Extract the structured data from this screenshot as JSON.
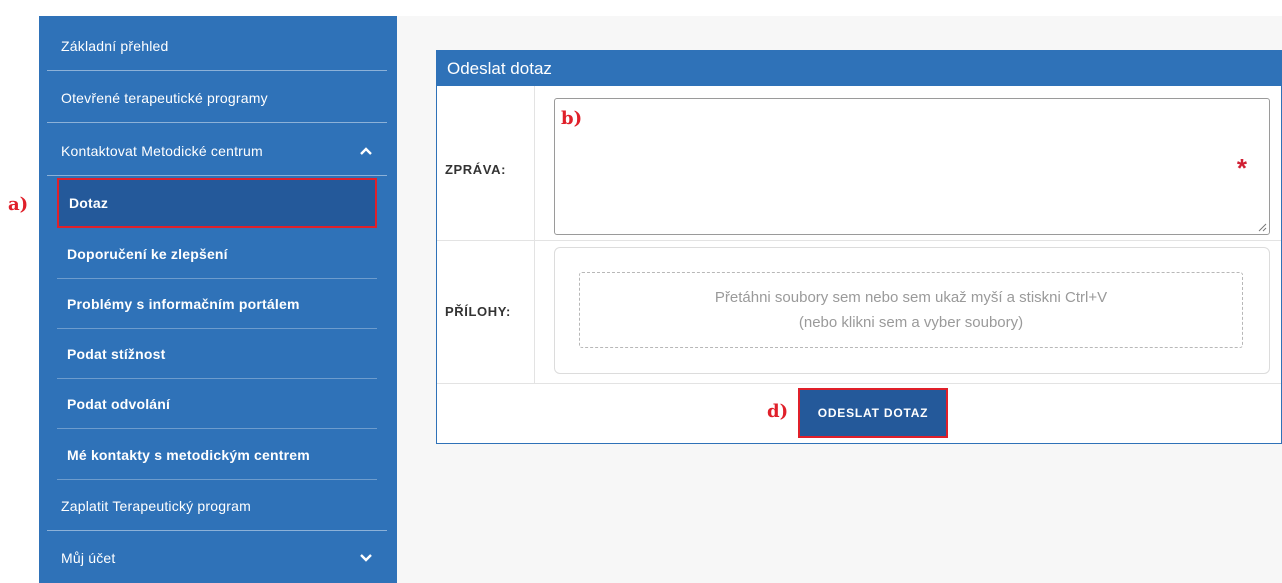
{
  "sidebar": {
    "items": [
      {
        "label": "Základní přehled"
      },
      {
        "label": "Otevřené terapeutické programy"
      },
      {
        "label": "Kontaktovat Metodické centrum",
        "expanded": true,
        "icon": "chevron-up-icon"
      },
      {
        "label": "Zaplatit Terapeutický program"
      },
      {
        "label": "Můj účet",
        "expanded": false,
        "icon": "chevron-down-icon"
      }
    ],
    "subitems": [
      {
        "label": "Dotaz",
        "active": true
      },
      {
        "label": "Doporučení ke zlepšení"
      },
      {
        "label": "Problémy s informačním portálem"
      },
      {
        "label": "Podat stížnost"
      },
      {
        "label": "Podat odvolání"
      },
      {
        "label": "Mé kontakty s metodickým centrem"
      }
    ]
  },
  "form": {
    "title": "Odeslat dotaz",
    "message_label": "ZPRÁVA:",
    "message_value": "",
    "required_marker": "*",
    "attachments_label": "PŘÍLOHY:",
    "dropzone_line1": "Přetáhni soubory sem nebo sem ukaž myší a stiskni Ctrl+V",
    "dropzone_line2": "(nebo klikni sem a vyber soubory)",
    "submit_label": "ODESLAT DOTAZ"
  },
  "annotations": {
    "a": "a)",
    "b": "b)",
    "d": "d)"
  },
  "colors": {
    "sidebar_bg": "#2f72b8",
    "active_bg": "#24599a",
    "highlight": "#e0202a",
    "required": "#d01f33"
  }
}
